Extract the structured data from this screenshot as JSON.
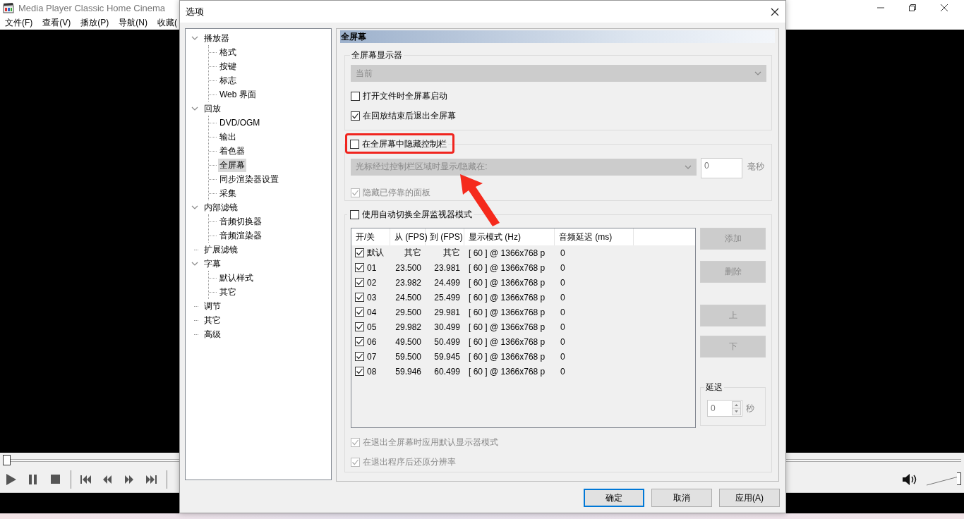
{
  "main_window": {
    "title": "Media Player Classic Home Cinema",
    "menu": [
      "文件(F)",
      "查看(V)",
      "播放(P)",
      "导航(N)",
      "收藏("
    ],
    "seek": {
      "level": 0
    },
    "volume": {
      "level": 1
    }
  },
  "dialog": {
    "title": "选项",
    "tree": [
      {
        "label": "播放器",
        "expanded": true,
        "selected": false,
        "children": [
          {
            "label": "格式",
            "selected": false
          },
          {
            "label": "按键",
            "selected": false
          },
          {
            "label": "标志",
            "selected": false
          },
          {
            "label": "Web 界面",
            "selected": false
          }
        ]
      },
      {
        "label": "回放",
        "expanded": true,
        "selected": false,
        "children": [
          {
            "label": "DVD/OGM",
            "selected": false
          },
          {
            "label": "输出",
            "selected": false
          },
          {
            "label": "着色器",
            "selected": false
          },
          {
            "label": "全屏幕",
            "selected": true
          },
          {
            "label": "同步渲染器设置",
            "selected": false
          },
          {
            "label": "采集",
            "selected": false
          }
        ]
      },
      {
        "label": "内部滤镜",
        "expanded": true,
        "selected": false,
        "children": [
          {
            "label": "音频切换器",
            "selected": false
          },
          {
            "label": "音频渲染器",
            "selected": false
          }
        ]
      },
      {
        "label": "扩展滤镜",
        "selected": false
      },
      {
        "label": "字幕",
        "expanded": true,
        "selected": false,
        "children": [
          {
            "label": "默认样式",
            "selected": false
          },
          {
            "label": "其它",
            "selected": false
          }
        ]
      },
      {
        "label": "调节",
        "selected": false
      },
      {
        "label": "其它",
        "selected": false
      },
      {
        "label": "高级",
        "selected": false
      }
    ],
    "page_title": "全屏幕",
    "monitor_group": {
      "title": "全屏幕显示器",
      "monitor": {
        "value": "当前",
        "disabled": true
      },
      "options": [
        {
          "label": "打开文件时全屏幕启动",
          "checked": false
        },
        {
          "label": "在回放结束后退出全屏幕",
          "checked": true
        }
      ]
    },
    "hide_controls": {
      "label": "在全屏幕中隐藏控制栏",
      "checked": false,
      "mode": {
        "value": "光标经过控制栏区域时显示/隐藏在:",
        "disabled": true
      },
      "delay": {
        "value": "0",
        "disabled": true
      },
      "unit": "毫秒",
      "hide_panels": {
        "label": "隐藏已停靠的面板",
        "checked": true,
        "disabled": true
      }
    },
    "auto_switch": {
      "label": "使用自动切换全屏监视器模式",
      "checked": false,
      "table": {
        "columns": [
          "开/关",
          "从 (FPS)",
          "到 (FPS)",
          "显示模式 (Hz)",
          "音频延迟 (ms)"
        ],
        "rows": [
          {
            "checked": true,
            "cells": [
              "默认",
              "其它",
              "其它",
              "[ 60 ] @ 1366x768 p",
              "0"
            ]
          },
          {
            "checked": true,
            "cells": [
              "01",
              "23.500",
              "23.981",
              "[ 60 ] @ 1366x768 p",
              "0"
            ]
          },
          {
            "checked": true,
            "cells": [
              "02",
              "23.982",
              "24.499",
              "[ 60 ] @ 1366x768 p",
              "0"
            ]
          },
          {
            "checked": true,
            "cells": [
              "03",
              "24.500",
              "25.499",
              "[ 60 ] @ 1366x768 p",
              "0"
            ]
          },
          {
            "checked": true,
            "cells": [
              "04",
              "29.500",
              "29.981",
              "[ 60 ] @ 1366x768 p",
              "0"
            ]
          },
          {
            "checked": true,
            "cells": [
              "05",
              "29.982",
              "30.499",
              "[ 60 ] @ 1366x768 p",
              "0"
            ]
          },
          {
            "checked": true,
            "cells": [
              "06",
              "49.500",
              "50.499",
              "[ 60 ] @ 1366x768 p",
              "0"
            ]
          },
          {
            "checked": true,
            "cells": [
              "07",
              "59.500",
              "59.945",
              "[ 60 ] @ 1366x768 p",
              "0"
            ]
          },
          {
            "checked": true,
            "cells": [
              "08",
              "59.946",
              "60.499",
              "[ 60 ] @ 1366x768 p",
              "0"
            ]
          }
        ]
      },
      "side_buttons": [
        {
          "label": "添加",
          "disabled": true
        },
        {
          "label": "删除",
          "disabled": true
        },
        {
          "label": "上",
          "disabled": true
        },
        {
          "label": "下",
          "disabled": true
        }
      ],
      "delay_group": {
        "title": "延迟",
        "value": "0",
        "unit": "秒",
        "disabled": true
      },
      "footer_options": [
        {
          "label": "在退出全屏幕时应用默认显示器模式",
          "checked": true,
          "disabled": true
        },
        {
          "label": "在退出程序后还原分辨率",
          "checked": true,
          "disabled": true
        }
      ]
    },
    "buttons": [
      {
        "label": "确定",
        "default": true
      },
      {
        "label": "取消",
        "default": false
      },
      {
        "label": "应用(A)",
        "default": false
      }
    ]
  }
}
